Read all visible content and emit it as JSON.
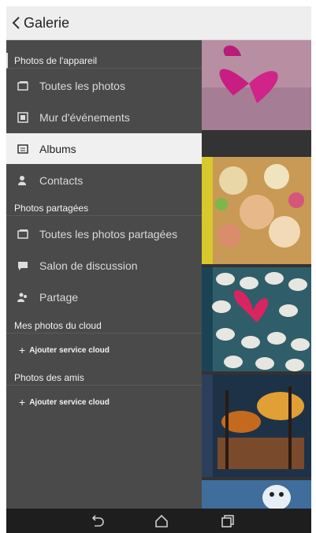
{
  "header": {
    "title": "Galerie"
  },
  "drawer": {
    "sections": [
      {
        "label": "Photos de l'appareil"
      },
      {
        "label": "Photos partagées"
      },
      {
        "label": "Mes photos du cloud"
      },
      {
        "label": "Photos des amis"
      }
    ],
    "items": [
      {
        "label": "Toutes les photos",
        "icon": "photos-icon"
      },
      {
        "label": "Mur d'événements",
        "icon": "event-wall-icon"
      },
      {
        "label": "Albums",
        "icon": "album-icon",
        "selected": true
      },
      {
        "label": "Contacts",
        "icon": "contacts-icon"
      },
      {
        "label": "Toutes les photos partagées",
        "icon": "shared-photos-icon"
      },
      {
        "label": "Salon de discussion",
        "icon": "chat-icon"
      },
      {
        "label": "Partage",
        "icon": "share-people-icon"
      }
    ],
    "add_cloud_1": "Ajouter service cloud",
    "add_cloud_2": "Ajouter service cloud"
  },
  "navbar": {
    "buttons": [
      "back-icon",
      "home-icon",
      "recent-apps-icon"
    ]
  },
  "colors": {
    "drawer_bg": "#4a4a4a",
    "selected_bg": "#f0f0f0",
    "topbar_bg": "#eeeeee",
    "navbar_bg": "#1e1e1e"
  }
}
